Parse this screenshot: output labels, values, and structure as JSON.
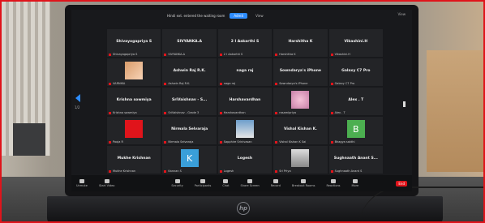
{
  "banner": {
    "message": "Hindi ext. entered the waiting room",
    "primary": "Admit",
    "secondary": "View"
  },
  "view_label": "View",
  "tiles": [
    {
      "name": "Shivayogapriya S",
      "label": "Shivayogapriya S",
      "pic": ""
    },
    {
      "name": "SIVYANKA.A",
      "label": "SIVYANKA.A",
      "pic": ""
    },
    {
      "name": "2 I Aakarthi S",
      "label": "2 I Aakarthi S",
      "pic": ""
    },
    {
      "name": "Harshitha K",
      "label": "Harshitha K",
      "pic": ""
    },
    {
      "name": "Vikashini.H",
      "label": "Vikashini.H",
      "pic": ""
    },
    {
      "name": "",
      "label": "VARNIKA",
      "pic": "mango"
    },
    {
      "name": "Ashwin Raj R.K.",
      "label": "Ashwin Raj R.K.",
      "pic": ""
    },
    {
      "name": "naga raj",
      "label": "naga raj",
      "pic": ""
    },
    {
      "name": "Sowndarya's iPhone",
      "label": "Sowndarya's iPhone",
      "pic": ""
    },
    {
      "name": "Galaxy C7 Pro",
      "label": "Galaxy C7 Pro",
      "pic": ""
    },
    {
      "name": "Krishna sowmiya",
      "label": "Krishna sowmiya",
      "pic": ""
    },
    {
      "name": "SriVaishnav - S...",
      "label": "SriVaishnav - Grade 3",
      "pic": ""
    },
    {
      "name": "Harshavardhan",
      "label": "Harshavardhan",
      "pic": ""
    },
    {
      "name": "",
      "label": "rasamipriya",
      "pic": "flower"
    },
    {
      "name": "Alex . T",
      "label": "Alex . T",
      "pic": ""
    },
    {
      "name": "",
      "label": "Pooja R",
      "pic": "avatar"
    },
    {
      "name": "Nirmala Selvaraja",
      "label": "Nirmala Selvaraja",
      "pic": ""
    },
    {
      "name": "",
      "label": "Sapphire Srinivasan",
      "pic": "person"
    },
    {
      "name": "Vishal Kishan K.",
      "label": "Vishal Kishan K Sai",
      "pic": ""
    },
    {
      "name": "",
      "label": "Bhagya sakthi",
      "pic": "b"
    },
    {
      "name": "Mukhe Krishnan",
      "label": "Mukhe Krishnan",
      "pic": ""
    },
    {
      "name": "",
      "label": "Kannan S",
      "pic": "k"
    },
    {
      "name": "Logesh",
      "label": "Logesh",
      "pic": ""
    },
    {
      "name": "",
      "label": "Sri Priya",
      "pic": "photo"
    },
    {
      "name": "Sughnaath Anant S...",
      "label": "Sughnaath Anant S",
      "pic": ""
    }
  ],
  "letters": {
    "k": "K",
    "b": "B"
  },
  "page_indicator": "1/2",
  "toolbar": [
    {
      "label": "Unmute"
    },
    {
      "label": "Start Video"
    },
    {
      "label": "Security"
    },
    {
      "label": "Participants"
    },
    {
      "label": "Chat"
    },
    {
      "label": "Share Screen"
    },
    {
      "label": "Record"
    },
    {
      "label": "Breakout Rooms"
    },
    {
      "label": "Reactions"
    },
    {
      "label": "More"
    }
  ],
  "end_label": "End",
  "hp_logo": "hp"
}
